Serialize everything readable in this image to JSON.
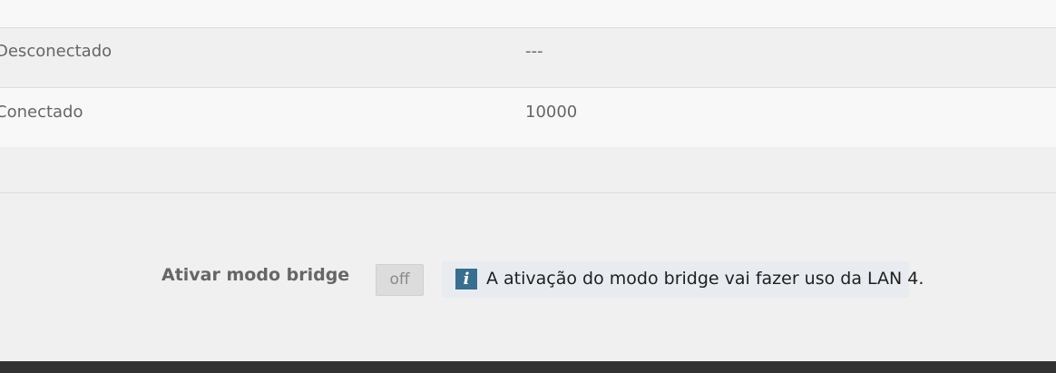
{
  "table": {
    "rows": [
      {
        "status": "Desconectado",
        "speed": "---"
      },
      {
        "status": "Conectado",
        "speed": "10000"
      }
    ]
  },
  "bridge": {
    "label": "Ativar modo bridge",
    "toggle_state": "off",
    "info_icon": "info-icon",
    "info_text": "A ativação do modo bridge vai fazer uso da LAN 4."
  },
  "colors": {
    "info_icon_bg": "#3a6e8e",
    "info_box_bg": "#e8ecf1",
    "footer_bg": "#333333"
  }
}
